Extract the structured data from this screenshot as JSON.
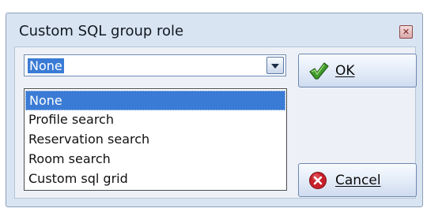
{
  "window": {
    "title": "Custom SQL group role",
    "close_icon": "close-icon"
  },
  "combo": {
    "selected_value": "None",
    "arrow_icon": "chevron-down-icon"
  },
  "dropdown": {
    "options": [
      "None",
      "Profile search",
      "Reservation search",
      "Room search",
      "Custom sql grid"
    ],
    "highlighted_index": 0
  },
  "buttons": {
    "ok_label": "OK",
    "ok_icon": "checkmark-icon",
    "cancel_label": "Cancel",
    "cancel_icon": "cancel-icon"
  },
  "colors": {
    "selection": "#3a7bd5",
    "dialog_background": "#d9e4f2",
    "ok_check": "#3f9a2c",
    "cancel_red": "#c8202a"
  }
}
